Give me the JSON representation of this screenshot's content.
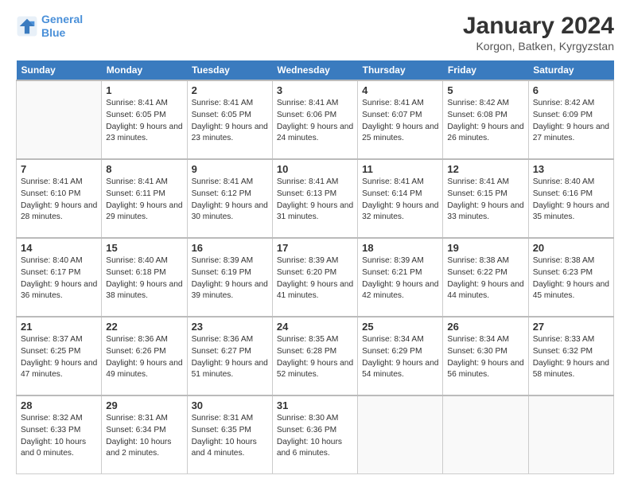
{
  "header": {
    "logo_line1": "General",
    "logo_line2": "Blue",
    "title": "January 2024",
    "subtitle": "Korgon, Batken, Kyrgyzstan"
  },
  "weekdays": [
    "Sunday",
    "Monday",
    "Tuesday",
    "Wednesday",
    "Thursday",
    "Friday",
    "Saturday"
  ],
  "weeks": [
    [
      {
        "day": "",
        "sunrise": "",
        "sunset": "",
        "daylight": ""
      },
      {
        "day": "1",
        "sunrise": "Sunrise: 8:41 AM",
        "sunset": "Sunset: 6:05 PM",
        "daylight": "Daylight: 9 hours and 23 minutes."
      },
      {
        "day": "2",
        "sunrise": "Sunrise: 8:41 AM",
        "sunset": "Sunset: 6:05 PM",
        "daylight": "Daylight: 9 hours and 23 minutes."
      },
      {
        "day": "3",
        "sunrise": "Sunrise: 8:41 AM",
        "sunset": "Sunset: 6:06 PM",
        "daylight": "Daylight: 9 hours and 24 minutes."
      },
      {
        "day": "4",
        "sunrise": "Sunrise: 8:41 AM",
        "sunset": "Sunset: 6:07 PM",
        "daylight": "Daylight: 9 hours and 25 minutes."
      },
      {
        "day": "5",
        "sunrise": "Sunrise: 8:42 AM",
        "sunset": "Sunset: 6:08 PM",
        "daylight": "Daylight: 9 hours and 26 minutes."
      },
      {
        "day": "6",
        "sunrise": "Sunrise: 8:42 AM",
        "sunset": "Sunset: 6:09 PM",
        "daylight": "Daylight: 9 hours and 27 minutes."
      }
    ],
    [
      {
        "day": "7",
        "sunrise": "Sunrise: 8:41 AM",
        "sunset": "Sunset: 6:10 PM",
        "daylight": "Daylight: 9 hours and 28 minutes."
      },
      {
        "day": "8",
        "sunrise": "Sunrise: 8:41 AM",
        "sunset": "Sunset: 6:11 PM",
        "daylight": "Daylight: 9 hours and 29 minutes."
      },
      {
        "day": "9",
        "sunrise": "Sunrise: 8:41 AM",
        "sunset": "Sunset: 6:12 PM",
        "daylight": "Daylight: 9 hours and 30 minutes."
      },
      {
        "day": "10",
        "sunrise": "Sunrise: 8:41 AM",
        "sunset": "Sunset: 6:13 PM",
        "daylight": "Daylight: 9 hours and 31 minutes."
      },
      {
        "day": "11",
        "sunrise": "Sunrise: 8:41 AM",
        "sunset": "Sunset: 6:14 PM",
        "daylight": "Daylight: 9 hours and 32 minutes."
      },
      {
        "day": "12",
        "sunrise": "Sunrise: 8:41 AM",
        "sunset": "Sunset: 6:15 PM",
        "daylight": "Daylight: 9 hours and 33 minutes."
      },
      {
        "day": "13",
        "sunrise": "Sunrise: 8:40 AM",
        "sunset": "Sunset: 6:16 PM",
        "daylight": "Daylight: 9 hours and 35 minutes."
      }
    ],
    [
      {
        "day": "14",
        "sunrise": "Sunrise: 8:40 AM",
        "sunset": "Sunset: 6:17 PM",
        "daylight": "Daylight: 9 hours and 36 minutes."
      },
      {
        "day": "15",
        "sunrise": "Sunrise: 8:40 AM",
        "sunset": "Sunset: 6:18 PM",
        "daylight": "Daylight: 9 hours and 38 minutes."
      },
      {
        "day": "16",
        "sunrise": "Sunrise: 8:39 AM",
        "sunset": "Sunset: 6:19 PM",
        "daylight": "Daylight: 9 hours and 39 minutes."
      },
      {
        "day": "17",
        "sunrise": "Sunrise: 8:39 AM",
        "sunset": "Sunset: 6:20 PM",
        "daylight": "Daylight: 9 hours and 41 minutes."
      },
      {
        "day": "18",
        "sunrise": "Sunrise: 8:39 AM",
        "sunset": "Sunset: 6:21 PM",
        "daylight": "Daylight: 9 hours and 42 minutes."
      },
      {
        "day": "19",
        "sunrise": "Sunrise: 8:38 AM",
        "sunset": "Sunset: 6:22 PM",
        "daylight": "Daylight: 9 hours and 44 minutes."
      },
      {
        "day": "20",
        "sunrise": "Sunrise: 8:38 AM",
        "sunset": "Sunset: 6:23 PM",
        "daylight": "Daylight: 9 hours and 45 minutes."
      }
    ],
    [
      {
        "day": "21",
        "sunrise": "Sunrise: 8:37 AM",
        "sunset": "Sunset: 6:25 PM",
        "daylight": "Daylight: 9 hours and 47 minutes."
      },
      {
        "day": "22",
        "sunrise": "Sunrise: 8:36 AM",
        "sunset": "Sunset: 6:26 PM",
        "daylight": "Daylight: 9 hours and 49 minutes."
      },
      {
        "day": "23",
        "sunrise": "Sunrise: 8:36 AM",
        "sunset": "Sunset: 6:27 PM",
        "daylight": "Daylight: 9 hours and 51 minutes."
      },
      {
        "day": "24",
        "sunrise": "Sunrise: 8:35 AM",
        "sunset": "Sunset: 6:28 PM",
        "daylight": "Daylight: 9 hours and 52 minutes."
      },
      {
        "day": "25",
        "sunrise": "Sunrise: 8:34 AM",
        "sunset": "Sunset: 6:29 PM",
        "daylight": "Daylight: 9 hours and 54 minutes."
      },
      {
        "day": "26",
        "sunrise": "Sunrise: 8:34 AM",
        "sunset": "Sunset: 6:30 PM",
        "daylight": "Daylight: 9 hours and 56 minutes."
      },
      {
        "day": "27",
        "sunrise": "Sunrise: 8:33 AM",
        "sunset": "Sunset: 6:32 PM",
        "daylight": "Daylight: 9 hours and 58 minutes."
      }
    ],
    [
      {
        "day": "28",
        "sunrise": "Sunrise: 8:32 AM",
        "sunset": "Sunset: 6:33 PM",
        "daylight": "Daylight: 10 hours and 0 minutes."
      },
      {
        "day": "29",
        "sunrise": "Sunrise: 8:31 AM",
        "sunset": "Sunset: 6:34 PM",
        "daylight": "Daylight: 10 hours and 2 minutes."
      },
      {
        "day": "30",
        "sunrise": "Sunrise: 8:31 AM",
        "sunset": "Sunset: 6:35 PM",
        "daylight": "Daylight: 10 hours and 4 minutes."
      },
      {
        "day": "31",
        "sunrise": "Sunrise: 8:30 AM",
        "sunset": "Sunset: 6:36 PM",
        "daylight": "Daylight: 10 hours and 6 minutes."
      },
      {
        "day": "",
        "sunrise": "",
        "sunset": "",
        "daylight": ""
      },
      {
        "day": "",
        "sunrise": "",
        "sunset": "",
        "daylight": ""
      },
      {
        "day": "",
        "sunrise": "",
        "sunset": "",
        "daylight": ""
      }
    ]
  ]
}
